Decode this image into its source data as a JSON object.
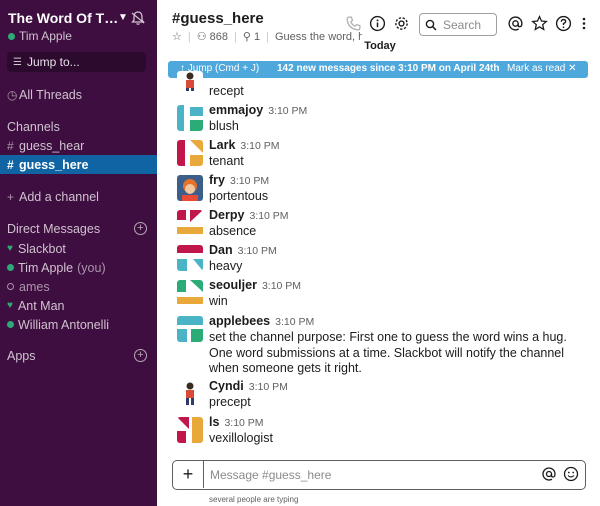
{
  "workspace": {
    "name": "The Word Of Th...",
    "user": "Tim Apple"
  },
  "sidebar": {
    "jump_label": "Jump to...",
    "all_threads": "All Threads",
    "channels_header": "Channels",
    "channels": [
      {
        "name": "guess_hear"
      },
      {
        "name": "guess_here",
        "active": true
      }
    ],
    "add_channel": "Add a channel",
    "dm_header": "Direct Messages",
    "dms": [
      {
        "name": "Slackbot"
      },
      {
        "name": "Tim Apple",
        "suffix": "(you)"
      },
      {
        "name": "ames"
      },
      {
        "name": "Ant Man"
      },
      {
        "name": "William Antonelli"
      }
    ],
    "apps_header": "Apps"
  },
  "channel": {
    "title": "#guess_here",
    "member_count": "868",
    "pinned_count": "1",
    "topic": "Guess the word, h"
  },
  "header": {
    "search_placeholder": "Search"
  },
  "divider_label": "Today",
  "banner": {
    "jump": "↑ Jump (Cmd + J)",
    "new_messages": "142 new messages since 3:10 PM on April 24th",
    "mark_read": "Mark as read ✕"
  },
  "messages": [
    {
      "name": "",
      "time": "",
      "text": "recept",
      "avatar": "photo-a"
    },
    {
      "name": "emmajoy",
      "time": "3:10 PM",
      "text": "blush",
      "avatar": "identicon-teal"
    },
    {
      "name": "Lark",
      "time": "3:10 PM",
      "text": "tenant",
      "avatar": "identicon-red"
    },
    {
      "name": "fry",
      "time": "3:10 PM",
      "text": "portentous",
      "avatar": "photo-b"
    },
    {
      "name": "Derpy",
      "time": "3:10 PM",
      "text": "absence",
      "avatar": "identicon-red2"
    },
    {
      "name": "Dan",
      "time": "3:10 PM",
      "text": "heavy",
      "avatar": "identicon-red3"
    },
    {
      "name": "seouljer",
      "time": "3:10 PM",
      "text": "win",
      "avatar": "identicon-green"
    },
    {
      "name": "applebees",
      "time": "3:10 PM",
      "text": "set the channel purpose: First one to guess the word wins a hug. One word submissions at a time. Slackbot will notify the channel when someone gets it right.",
      "avatar": "identicon-teal2"
    },
    {
      "name": "Cyndi",
      "time": "3:10 PM",
      "text": "precept",
      "avatar": "photo-a"
    },
    {
      "name": "ls",
      "time": "3:10 PM",
      "text": "vexillologist",
      "avatar": "identicon-red4"
    }
  ],
  "composer": {
    "placeholder": "Message #guess_here"
  },
  "typing_indicator": "several people are typing",
  "colors": {
    "sidebar": "#3f0e40",
    "active": "#1164a3",
    "banner": "#4fa8dc",
    "presence": "#2bac76"
  }
}
